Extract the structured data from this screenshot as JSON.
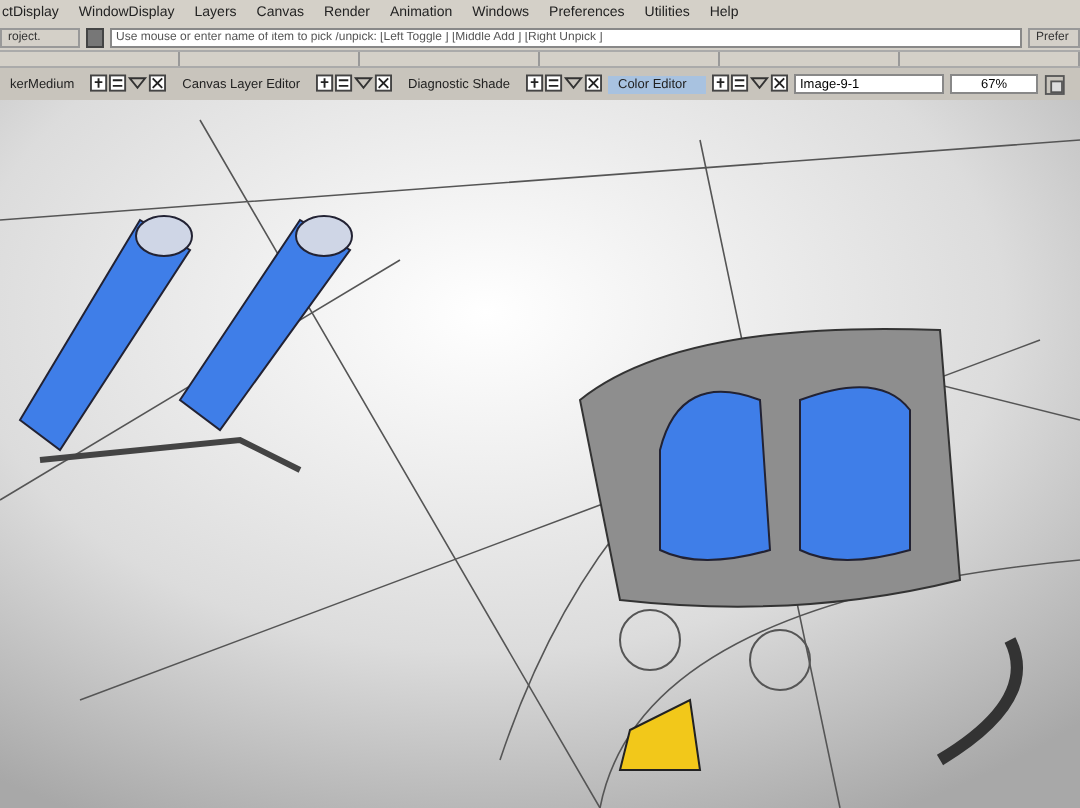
{
  "menu_bar": {
    "items": [
      "ctDisplay",
      "WindowDisplay",
      "Layers",
      "Canvas",
      "Render",
      "Animation",
      "Windows",
      "Preferences",
      "Utilities",
      "Help"
    ]
  },
  "pick_bar": {
    "left_button": "roject.",
    "placeholder": "Use mouse or enter name of item to pick /unpick: [Left Toggle ] [Middle Add ] [Right Unpick ]",
    "right_button": "Prefer"
  },
  "palette_tabs": [
    {
      "label": "kerMedium",
      "selected": false
    },
    {
      "label": "Canvas Layer Editor",
      "selected": false
    },
    {
      "label": "Diagnostic Shade",
      "selected": false
    },
    {
      "label": "Color Editor",
      "selected": true
    }
  ],
  "image_field": {
    "value": "Image-9-1"
  },
  "zoom_field": {
    "value": "67%"
  }
}
